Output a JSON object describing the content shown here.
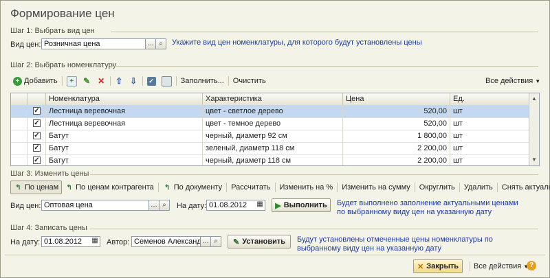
{
  "window_title": "Формирование цен",
  "step1": {
    "header": "Шаг 1: Выбрать вид цен",
    "label": "Вид цен:",
    "value": "Розничная цена",
    "hint": "Укажите вид цен номенклатуры, для которого будут установлены цены"
  },
  "step2": {
    "header": "Шаг 2: Выбрать номенклатуру",
    "toolbar": {
      "add": "Добавить",
      "fill": "Заполнить...",
      "clear": "Очистить",
      "all_actions": "Все действия"
    },
    "columns": [
      "Номенклатура",
      "Характеристика",
      "Цена",
      "Ед."
    ],
    "rows": [
      {
        "checked": true,
        "name": "Лестница веревочная",
        "char": "цвет - светлое дерево",
        "price": "520,00",
        "unit": "шт"
      },
      {
        "checked": true,
        "name": "Лестница веревочная",
        "char": "цвет - темное дерево",
        "price": "520,00",
        "unit": "шт"
      },
      {
        "checked": true,
        "name": "Батут",
        "char": "черный, диаметр 92 см",
        "price": "1 800,00",
        "unit": "шт"
      },
      {
        "checked": true,
        "name": "Батут",
        "char": "зеленый, диаметр 118 см",
        "price": "2 200,00",
        "unit": "шт"
      },
      {
        "checked": true,
        "name": "Батут",
        "char": "черный, диаметр 118 см",
        "price": "2 200,00",
        "unit": "шт"
      }
    ]
  },
  "step3": {
    "header": "Шаг 3: Изменить цены",
    "toolbar": [
      "По ценам",
      "По ценам контрагента",
      "По документу",
      "Рассчитать",
      "Изменить на %",
      "Изменить на сумму",
      "Округлить",
      "Удалить",
      "Снять актуальность"
    ],
    "price_label": "Вид цен:",
    "price_value": "Оптовая цена",
    "date_label": "На дату:",
    "date_value": "01.08.2012",
    "run_button": "Выполнить",
    "hint": "Будет выполнено заполнение актуальными ценами по выбранному виду цен на указанную дату"
  },
  "step4": {
    "header": "Шаг 4: Записать цены",
    "date_label": "На дату:",
    "date_value": "01.08.2012",
    "author_label": "Автор:",
    "author_value": "Семенов Александр",
    "set_button": "Установить",
    "hint": "Будут установлены отмеченные цены номенклатуры по выбранному виду цен на указанную дату"
  },
  "footer": {
    "close": "Закрыть",
    "all_actions": "Все действия",
    "help": "?"
  },
  "colors": {
    "accent_blue": "#1a3aa0",
    "selected_row": "#c4d9f0",
    "background": "#f4f3e8"
  }
}
